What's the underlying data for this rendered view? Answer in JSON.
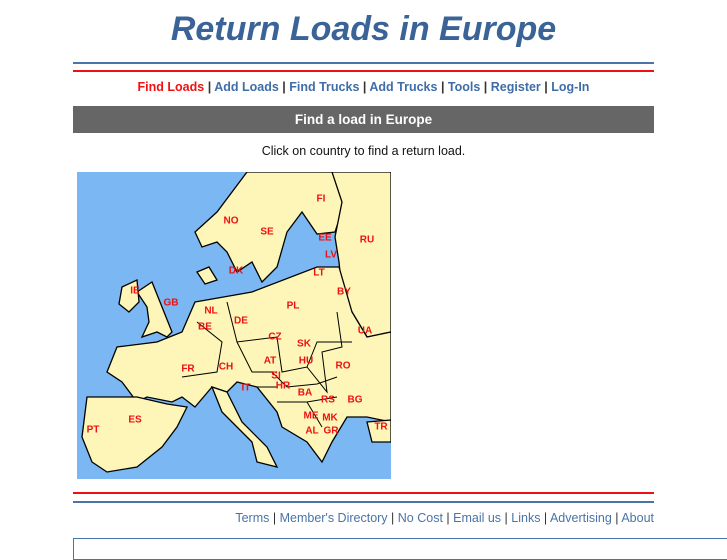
{
  "header": {
    "title": "Return Loads in Europe"
  },
  "nav": [
    {
      "label": "Find Loads",
      "active": true
    },
    {
      "label": "Add Loads"
    },
    {
      "label": "Find Trucks"
    },
    {
      "label": "Add Trucks"
    },
    {
      "label": "Tools"
    },
    {
      "label": "Register"
    },
    {
      "label": "Log-In"
    }
  ],
  "section": {
    "title": "Find a load in Europe",
    "instruction": "Click on country to find a return load."
  },
  "map": {
    "countries": [
      "FI",
      "NO",
      "SE",
      "EE",
      "RU",
      "LV",
      "DK",
      "LT",
      "IE",
      "BY",
      "GB",
      "NL",
      "PL",
      "BE",
      "DE",
      "UA",
      "CZ",
      "SK",
      "FR",
      "CH",
      "AT",
      "HU",
      "RO",
      "SI",
      "HR",
      "IT",
      "BA",
      "RS",
      "BG",
      "ES",
      "ME",
      "MK",
      "PT",
      "AL",
      "GR",
      "TR"
    ],
    "colors": {
      "sea": "#7bb7f2",
      "land": "#fdf6b8",
      "label": "#ee1111"
    }
  },
  "footer": [
    {
      "label": "Terms"
    },
    {
      "label": "Member's Directory"
    },
    {
      "label": "No Cost"
    },
    {
      "label": "Email us"
    },
    {
      "label": "Links"
    },
    {
      "label": "Advertising"
    },
    {
      "label": "About"
    }
  ],
  "colors": {
    "accent_blue": "#3a6398",
    "accent_red": "#ee1111",
    "bar": "#666666"
  }
}
